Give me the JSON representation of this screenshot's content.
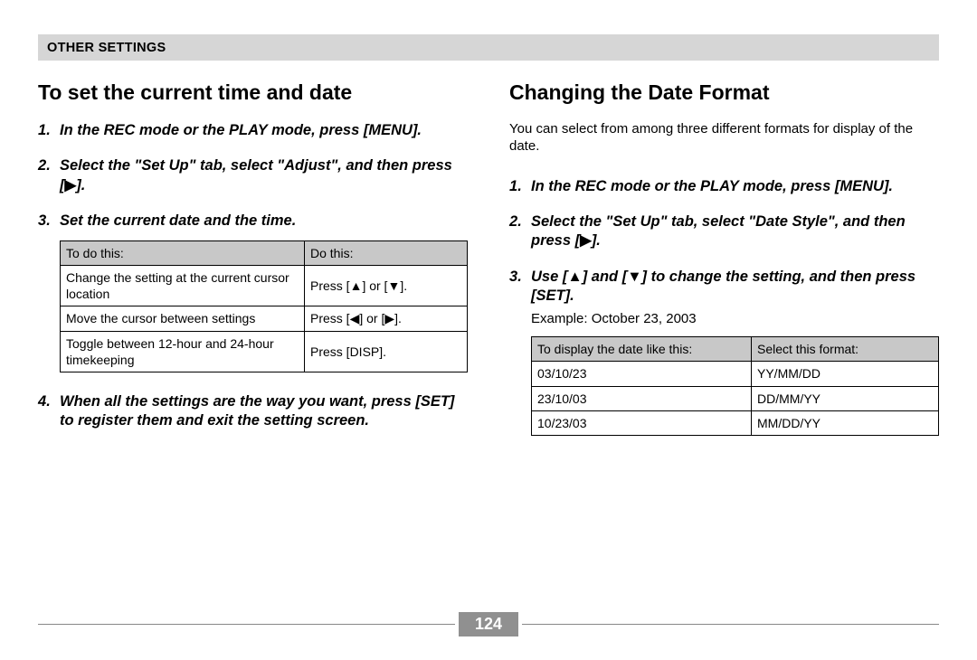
{
  "header": {
    "title": "OTHER SETTINGS"
  },
  "left": {
    "heading": "To set the current time and date",
    "steps": {
      "s1": "In the REC mode or the PLAY mode, press [MENU].",
      "s2_pre": "Select the \"Set Up\" tab, select \"Adjust\", and then press [",
      "s2_post": "].",
      "s3": "Set the current date and the time.",
      "s4": "When all the settings are the way you want, press [SET] to register them and exit the setting screen."
    },
    "table": {
      "h1": "To do this:",
      "h2": "Do this:",
      "r1c1": "Change the setting at the current cursor location",
      "r1c2_pre": "Press [",
      "r1c2_mid": "] or [",
      "r1c2_post": "].",
      "r2c1": "Move the cursor between settings",
      "r2c2_pre": "Press [",
      "r2c2_mid": "] or [",
      "r2c2_post": "].",
      "r3c1": "Toggle between 12-hour and 24-hour timekeeping",
      "r3c2": "Press [DISP]."
    }
  },
  "right": {
    "heading": "Changing the Date Format",
    "intro": "You can select from among three different formats for display of the date.",
    "steps": {
      "s1": "In the REC mode or the PLAY mode, press [MENU].",
      "s2_pre": "Select the \"Set Up\" tab, select \"Date Style\", and then press [",
      "s2_post": "].",
      "s3_pre": "Use [",
      "s3_mid": "] and [",
      "s3_post": "] to change the setting, and then press [SET]."
    },
    "example": "Example: October 23, 2003",
    "table": {
      "h1": "To display the date like this:",
      "h2": "Select this format:",
      "r1c1": "03/10/23",
      "r1c2": "YY/MM/DD",
      "r2c1": "23/10/03",
      "r2c2": "DD/MM/YY",
      "r3c1": "10/23/03",
      "r3c2": "MM/DD/YY"
    }
  },
  "glyphs": {
    "up": "▲",
    "down": "▼",
    "left": "◀",
    "right": "▶"
  },
  "page_number": "124"
}
